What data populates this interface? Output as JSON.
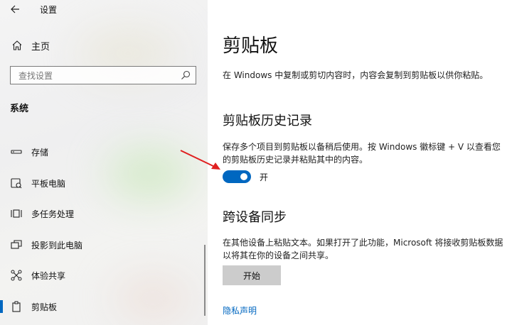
{
  "window": {
    "title": "设置"
  },
  "sidebar": {
    "home_label": "主页",
    "search_placeholder": "查找设置",
    "section_title": "系统",
    "items": [
      {
        "label": "存储",
        "icon": "storage-icon"
      },
      {
        "label": "平板电脑",
        "icon": "tablet-icon"
      },
      {
        "label": "多任务处理",
        "icon": "multitasking-icon"
      },
      {
        "label": "投影到此电脑",
        "icon": "projecting-icon"
      },
      {
        "label": "体验共享",
        "icon": "shared-experiences-icon"
      },
      {
        "label": "剪贴板",
        "icon": "clipboard-icon",
        "selected": true
      }
    ]
  },
  "main": {
    "title": "剪贴板",
    "description": "在 Windows 中复制或剪切内容时，内容会复制到剪贴板以供你粘贴。",
    "history": {
      "heading": "剪贴板历史记录",
      "description": "保存多个项目到剪贴板以备稍后使用。按 Windows 徽标键 + V 以查看您的剪贴板历史记录并粘贴其中的内容。",
      "toggle_on": true,
      "toggle_label": "开"
    },
    "sync": {
      "heading": "跨设备同步",
      "description": "在其他设备上粘贴文本。如果打开了此功能，Microsoft 将接收剪贴板数据以将其在你的设备之间共享。",
      "button_label": "开始"
    },
    "privacy_link": "隐私声明"
  },
  "colors": {
    "accent": "#0067c0",
    "annotation_arrow": "#e02020",
    "button_bg": "#cccccc"
  }
}
